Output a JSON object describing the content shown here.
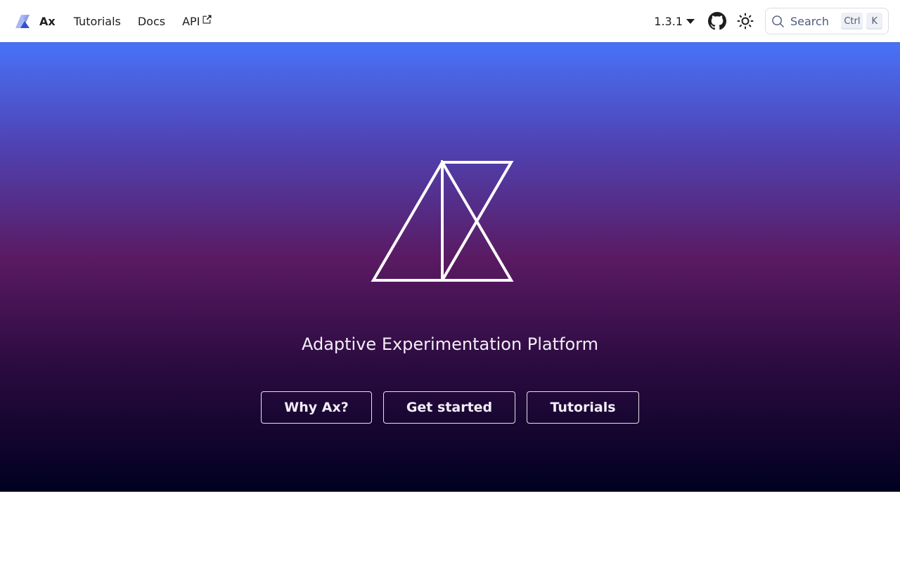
{
  "navbar": {
    "brand_title": "Ax",
    "links": [
      {
        "label": "Tutorials"
      },
      {
        "label": "Docs"
      },
      {
        "label": "API",
        "external": true
      }
    ],
    "version": "1.3.1",
    "icons": {
      "github": "github-icon",
      "theme": "sun-icon",
      "search": "search-icon"
    },
    "search": {
      "placeholder": "Search",
      "key1": "Ctrl",
      "key2": "K"
    }
  },
  "hero": {
    "tagline": "Adaptive Experimentation Platform",
    "buttons": [
      {
        "label": "Why Ax?"
      },
      {
        "label": "Get started"
      },
      {
        "label": "Tutorials"
      }
    ]
  },
  "colors": {
    "gradient_top": "#4873f8",
    "gradient_mid": "#5a1a62",
    "gradient_bottom": "#000020",
    "text_dark": "#1c1e21"
  }
}
